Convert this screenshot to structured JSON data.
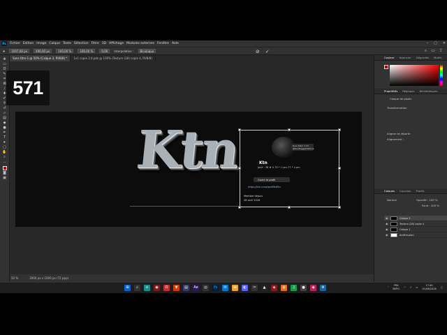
{
  "menubar": {
    "items": [
      "Fichier",
      "Edition",
      "Image",
      "Calque",
      "Texte",
      "Sélection",
      "Filtre",
      "3D",
      "Affichage",
      "Modules externes",
      "Fenêtre",
      "Aide"
    ]
  },
  "options": {
    "x": "1007,00 px",
    "y": "490,00 px",
    "w": "100,00 %",
    "h": "100,00 %",
    "angle": "0,00",
    "interp_label": "Interpolation :",
    "interp_value": "Bicubique"
  },
  "tabs": [
    {
      "label": "Sans titre-1 @ 50% (Calque 3, RVB/8) *"
    },
    {
      "label": "1x1 copie 3.0.psb @ 100% (Texture (28) copie 4, RVB/8)"
    }
  ],
  "overlay": {
    "counter": "571"
  },
  "artwork": {
    "logo_text": "Ktn",
    "badge": "Kuro Kami 1.13 @kurokiggghhakkuu",
    "card_title": "Ktn",
    "card_stats": "Joué : 38 ♦ 0   75 • 1 pm   77 • 4 pm",
    "pill": "Ouvrir le profil",
    "link": "https://ktn.crew/profile/Ktn",
    "footer1": "Membre depuis",
    "footer2": "28 avril 2026"
  },
  "statusbar": {
    "zoom": "50 %",
    "size": "3000 px x 1000 px (72 ppp)"
  },
  "panel": {
    "color_tabs": [
      "Couleur",
      "Nuancier",
      "Dégradés",
      "Motifs"
    ],
    "props_tabs": [
      "Propriétés",
      "Réglages",
      "Bibliothèques"
    ],
    "layer_kind": "Calque de pixels",
    "transform": "Transformation",
    "align": "Aligner et répartir",
    "align_sub": "Alignement :",
    "layer_tabs": [
      "Calques",
      "Couches",
      "Tracés"
    ],
    "blend": "Normal",
    "opacity": "Opacité : 100 %",
    "fill": "Fond : 100 %",
    "layers": [
      {
        "name": "Calque 3",
        "selected": true
      },
      {
        "name": "Texture (28) copie 4",
        "selected": false
      },
      {
        "name": "Calque 1",
        "selected": false
      },
      {
        "name": "Arrière-plan",
        "selected": false
      }
    ]
  },
  "tray": {
    "lang": "FRA",
    "layout": "BEPO",
    "time": "17:40",
    "date": "01/08/2026"
  }
}
